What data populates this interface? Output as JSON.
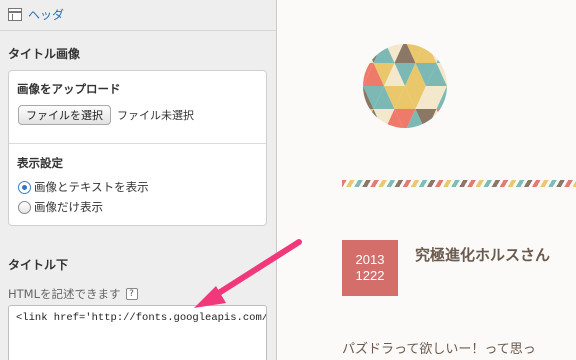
{
  "panel": {
    "header_link": "ヘッダ",
    "title_image": {
      "heading": "タイトル画像",
      "upload": {
        "heading": "画像をアップロード",
        "button": "ファイルを選択",
        "status": "ファイル未選択"
      },
      "display": {
        "heading": "表示設定",
        "options": [
          {
            "label": "画像とテキストを表示",
            "selected": true
          },
          {
            "label": "画像だけ表示",
            "selected": false
          }
        ]
      }
    },
    "title_under": {
      "heading": "タイトル下",
      "note": "HTMLを記述できます",
      "help": "?",
      "textarea_value": "<link href='http://fonts.googleapis.com/css?fa"
    }
  },
  "preview": {
    "date_year": "2013",
    "date_md": "1222",
    "post_title": "究極進化ホルスさん",
    "excerpt": "パズドラって欲しいー！って思っ"
  },
  "colors": {
    "accent_pink": "#f0387b",
    "date_box": "#d46e6b",
    "logo_red": "#ef7a6a",
    "logo_yellow": "#e9c76a",
    "logo_teal": "#7cb9b4",
    "logo_brown": "#8b7766",
    "logo_cream": "#f3e7cc"
  },
  "icons": {
    "header": "layout-header-icon",
    "help": "question-mark-icon",
    "arrow": "pointer-arrow"
  }
}
